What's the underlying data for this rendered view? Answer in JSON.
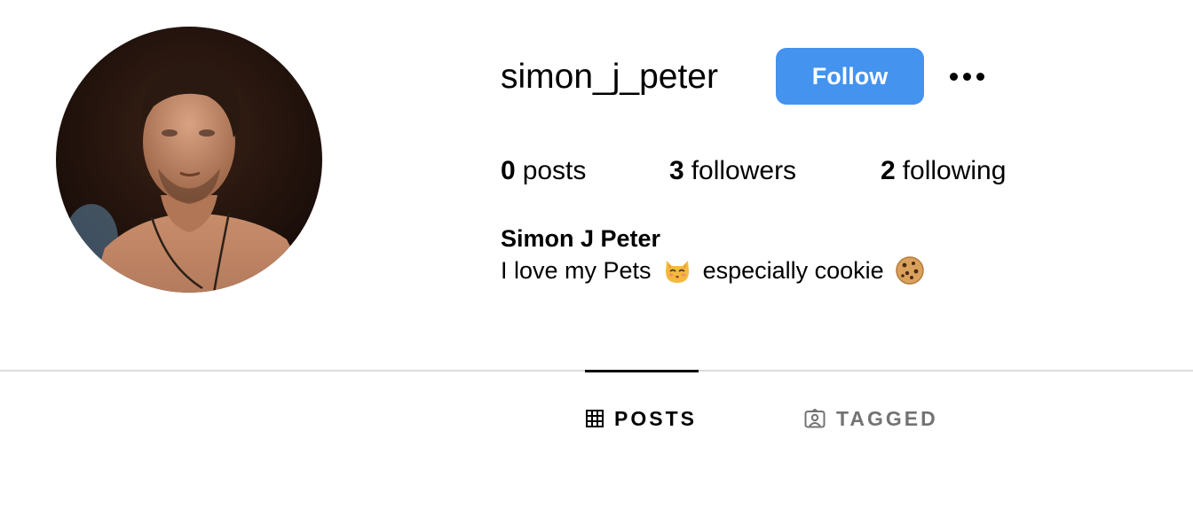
{
  "profile": {
    "username": "simon_j_peter",
    "follow_label": "Follow",
    "more_label": "•••",
    "full_name": "Simon J Peter",
    "bio_part1": "I love my Pets",
    "bio_part2": "especially cookie"
  },
  "stats": {
    "posts_count": "0",
    "posts_label": "posts",
    "followers_count": "3",
    "followers_label": "followers",
    "following_count": "2",
    "following_label": "following"
  },
  "tabs": [
    {
      "label": "POSTS",
      "icon": "grid-icon",
      "active": true
    },
    {
      "label": "TAGGED",
      "icon": "tagged-icon",
      "active": false
    }
  ],
  "colors": {
    "follow_button": "#4393ef",
    "divider": "#dbdbdb",
    "inactive_tab": "#737373"
  },
  "icons": {
    "bio_emoji_1": "kissing-cat-emoji",
    "bio_emoji_2": "cookie-emoji"
  }
}
